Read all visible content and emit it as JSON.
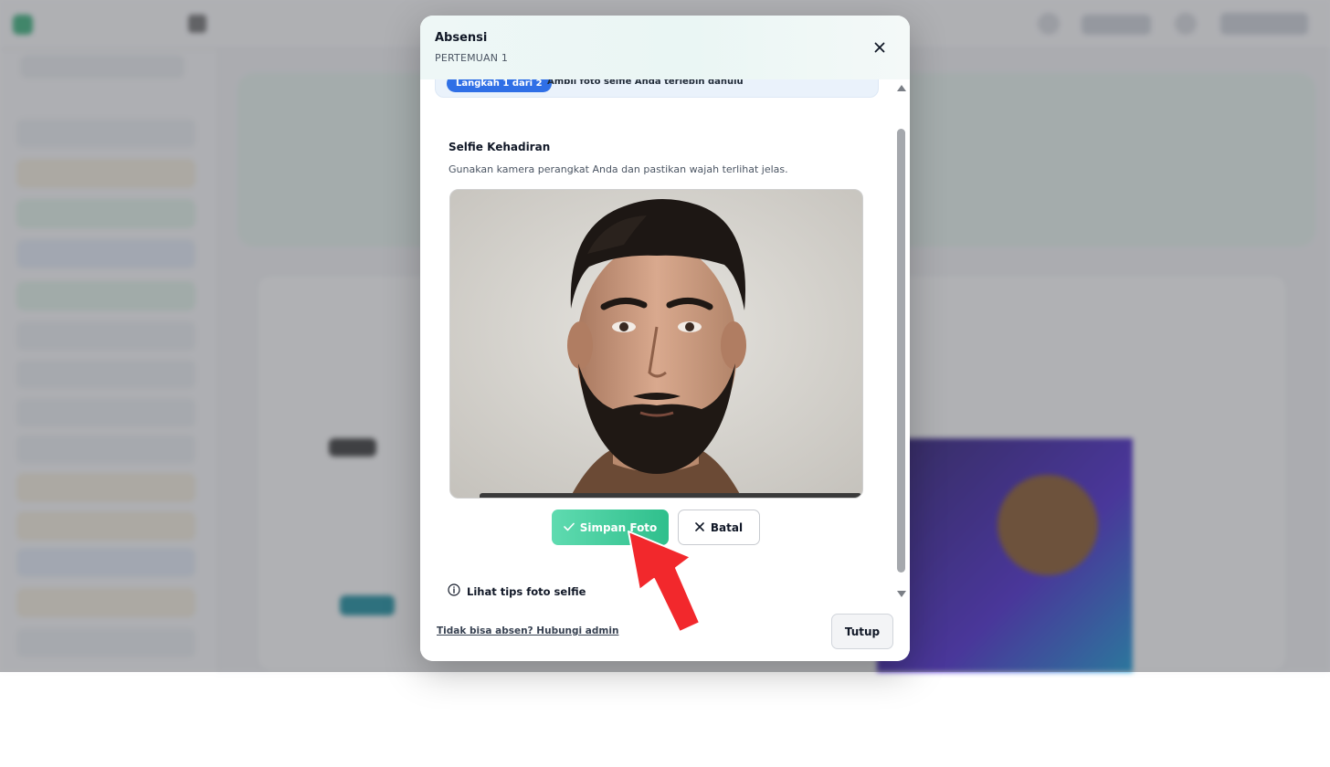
{
  "modal": {
    "title": "Absensi",
    "subtitle": "PERTEMUAN 1",
    "close_icon": "close-icon"
  },
  "step": {
    "badge": "Langkah 1 dari 2",
    "instruction": "Ambil foto selfie Anda terlebih dahulu"
  },
  "selfie": {
    "title": "Selfie Kehadiran",
    "description": "Gunakan kamera perangkat Anda dan pastikan wajah terlihat jelas.",
    "photo": "captured-selfie-photo"
  },
  "actions": {
    "save_label": "Simpan Foto",
    "save_icon": "check-icon",
    "cancel_label": "Batal",
    "cancel_icon": "x-icon"
  },
  "tips": {
    "label": "Lihat tips foto selfie",
    "icon": "info-icon"
  },
  "footer": {
    "contact_label": "Tidak bisa absen? Hubungi admin",
    "close_label": "Tutup"
  },
  "colors": {
    "primary_green": "#2fbf8c",
    "step_blue": "#2f6fe6",
    "annotation_red": "#f2282c"
  }
}
